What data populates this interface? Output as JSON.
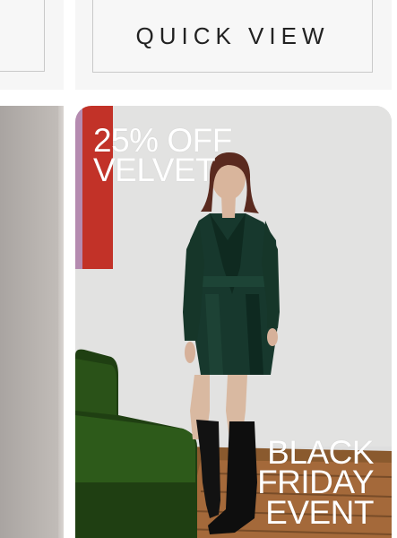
{
  "quick_view": {
    "label": "QUICK VIEW"
  },
  "product_tile": {
    "promo_top": [
      "25% OFF",
      "VELVET"
    ],
    "promo_bottom": [
      "BLACK",
      "FRIDAY",
      "EVENT"
    ]
  },
  "colors": {
    "card_bg": "#f6f6f6",
    "button_border": "#c9c9c9",
    "promo_text": "#ffffff",
    "accent_red": "#c0332a",
    "dress_green": "#17382d"
  }
}
